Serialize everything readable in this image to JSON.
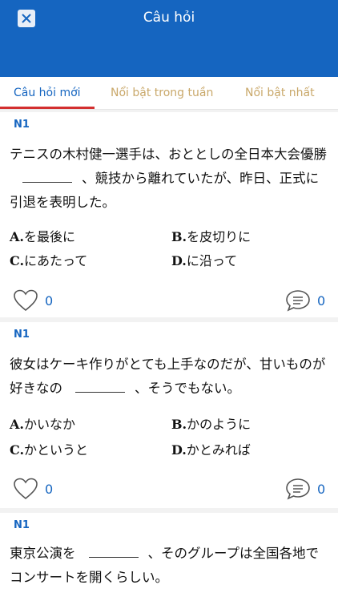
{
  "header": {
    "title": "Câu hỏi"
  },
  "tabs": [
    {
      "label": "Câu hỏi mới"
    },
    {
      "label": "Nổi bật trong tuần"
    },
    {
      "label": "Nổi bật nhất"
    }
  ],
  "questions": [
    {
      "level": "N1",
      "text_parts": [
        "テニスの木村健一選手は、おととしの全日本大会優勝",
        "、競技から離れていたが、昨日、正式に引退を表明した。"
      ],
      "options": [
        {
          "letter": "A.",
          "text": "を最後に"
        },
        {
          "letter": "B.",
          "text": "を皮切りに"
        },
        {
          "letter": "C.",
          "text": "にあたって"
        },
        {
          "letter": "D.",
          "text": "に沿って"
        }
      ],
      "likes": "0",
      "comments": "0"
    },
    {
      "level": "N1",
      "text_parts": [
        "彼女はケーキ作りがとても上手なのだが、甘いものが好きなの",
        "、そうでもない。"
      ],
      "options": [
        {
          "letter": "A.",
          "text": "かいなか"
        },
        {
          "letter": "B.",
          "text": "かのように"
        },
        {
          "letter": "C.",
          "text": "かというと"
        },
        {
          "letter": "D.",
          "text": "かとみれば"
        }
      ],
      "likes": "0",
      "comments": "0"
    },
    {
      "level": "N1",
      "text_parts": [
        "東京公演を",
        "、そのグループは全国各地でコンサートを開くらしい。"
      ]
    }
  ]
}
